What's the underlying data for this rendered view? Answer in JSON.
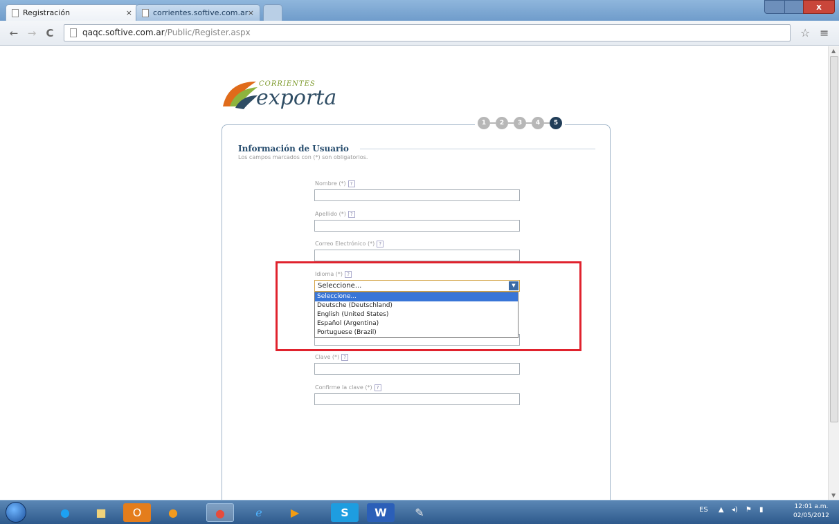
{
  "browser": {
    "tabs": [
      {
        "label": "Registración",
        "close": "×"
      },
      {
        "label": "corrientes.softive.com.ar",
        "close": "×"
      }
    ],
    "url_host": "qaqc.softive.com.ar",
    "url_path": "/Public/Register.aspx",
    "window_close": "x"
  },
  "logo": {
    "top": "CORRIENTES",
    "bottom": "exporta"
  },
  "steps": [
    "1",
    "2",
    "3",
    "4",
    "5"
  ],
  "form": {
    "title": "Información de Usuario",
    "note": "Los campos marcados con (*) son obligatorios.",
    "fields": {
      "nombre": "Nombre (*)",
      "apellido": "Apellido (*)",
      "correo": "Correo Electrónico (*)",
      "idioma": "Idioma (*)",
      "clave": "Clave (*)",
      "confirme": "Confirme la clave (*)"
    },
    "help": "?",
    "idioma_selected": "Seleccione...",
    "idioma_options": [
      "Seleccione...",
      "Deutsche (Deutschland)",
      "English (United States)",
      "Español (Argentina)",
      "Portuguese (Brazil)"
    ]
  },
  "taskbar": {
    "lang": "ES",
    "time": "12:01 a.m.",
    "date": "02/05/2012"
  },
  "colors": {
    "highlight": "#e0222d",
    "step_current": "#203d58",
    "title": "#274d6e"
  }
}
